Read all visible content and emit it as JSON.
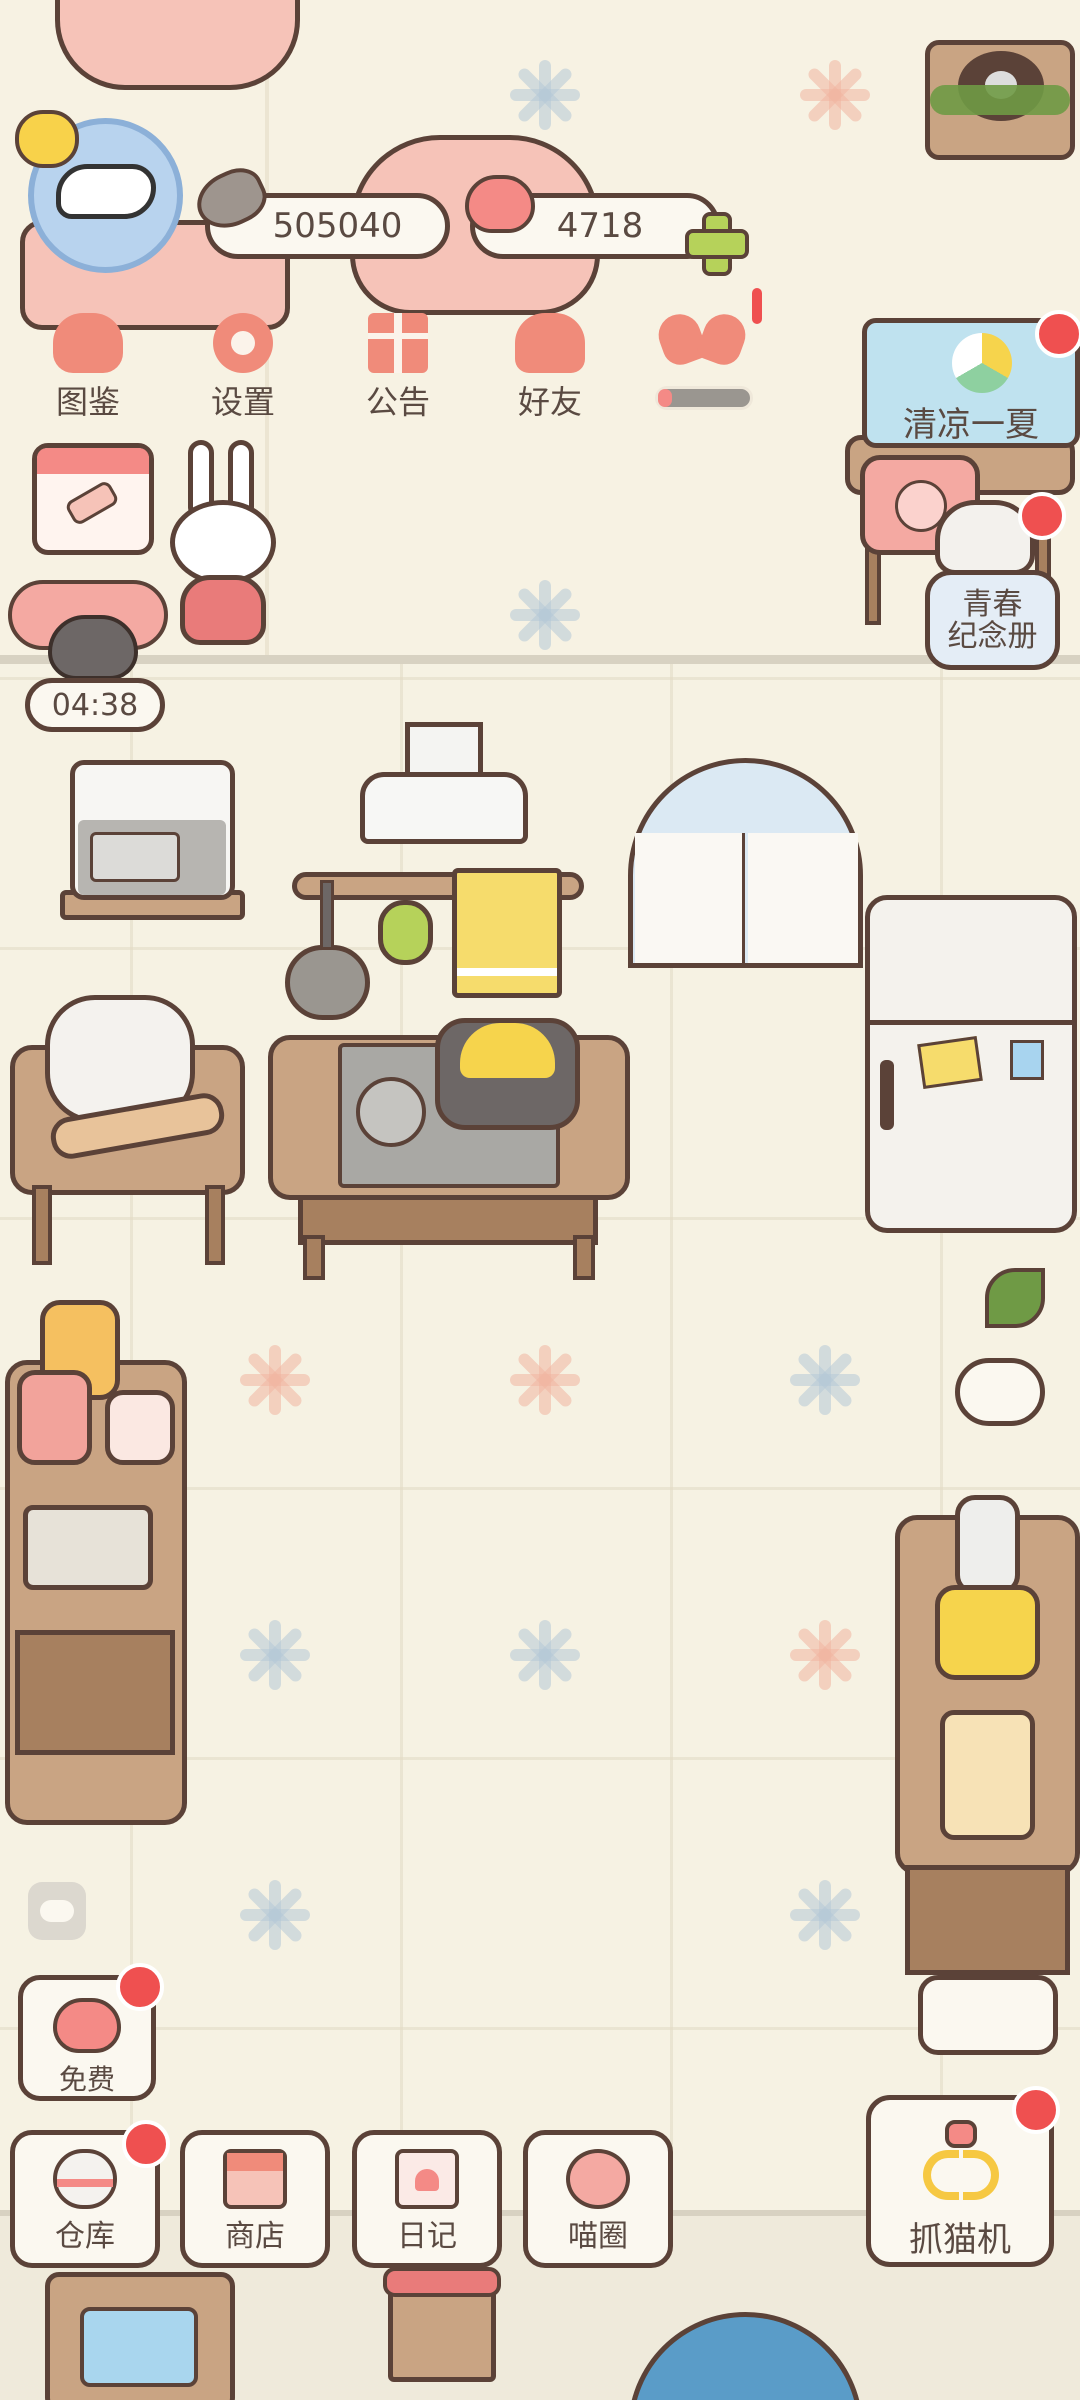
{
  "currency": {
    "fish": "505040",
    "hearts": "4718"
  },
  "top_menu": [
    {
      "label": "图鉴",
      "icon": "cat-head-icon"
    },
    {
      "label": "设置",
      "icon": "gear-icon"
    },
    {
      "label": "公告",
      "icon": "gift-icon"
    },
    {
      "label": "好友",
      "icon": "friends-icon"
    }
  ],
  "events": {
    "summer_label": "清凉一夏",
    "youth_label": "青春\n纪念册"
  },
  "timer": "04:38",
  "free_label": "免费",
  "bottom_menu": [
    {
      "label": "仓库",
      "icon": "storage-icon",
      "badge": true
    },
    {
      "label": "商店",
      "icon": "shop-icon",
      "badge": false
    },
    {
      "label": "日记",
      "icon": "diary-icon",
      "badge": false
    },
    {
      "label": "喵圈",
      "icon": "cat-planet-icon",
      "badge": false
    }
  ],
  "claw_machine_label": "抓猫机",
  "colors": {
    "outline": "#5b4238",
    "badge": "#ef5050",
    "accent_pink": "#f08b7a",
    "background": "#f7f3e6"
  }
}
